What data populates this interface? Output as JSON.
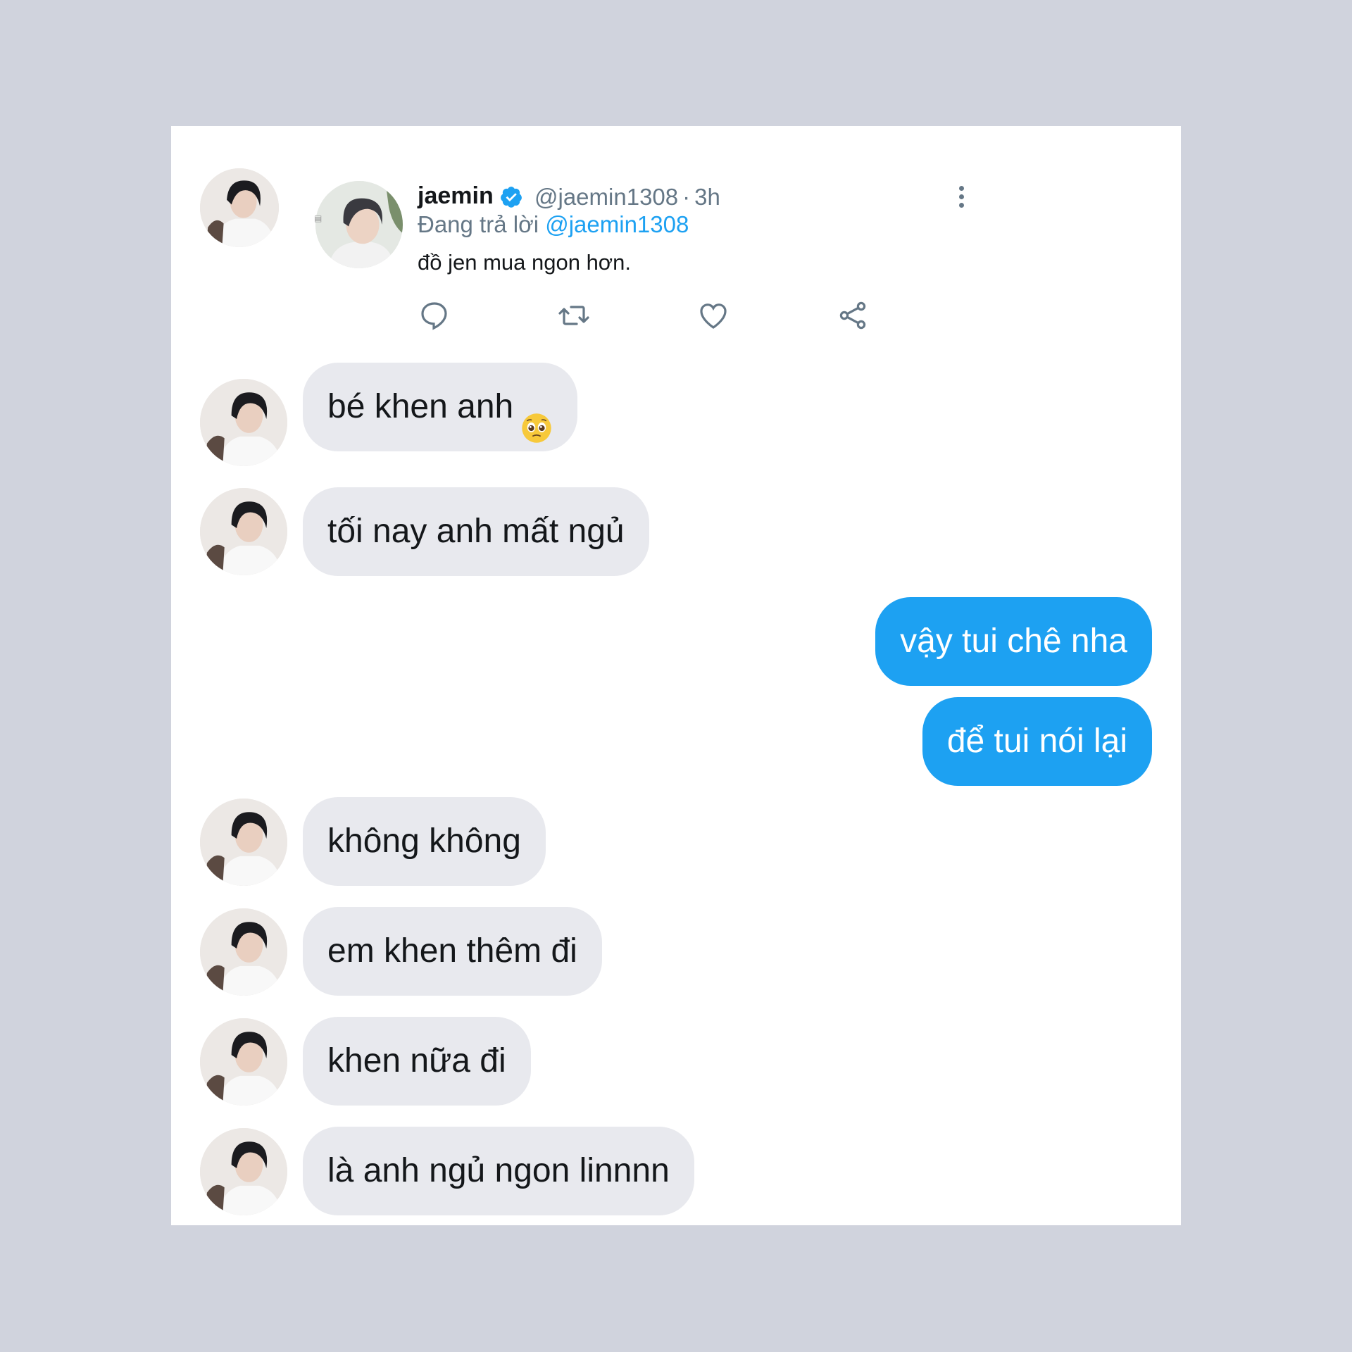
{
  "tweet": {
    "name": "jaemin",
    "handle": "@jaemin1308",
    "separator": "·",
    "time": "3h",
    "replying_prefix": "Đang trả lời",
    "replying_to": "@jaemin1308",
    "text": "đồ jen mua ngon hơn.",
    "verified_icon": "verified-badge-icon",
    "more_icon": "more-vertical-icon",
    "actions": [
      "reply-icon",
      "retweet-icon",
      "like-icon",
      "share-icon"
    ]
  },
  "messages": [
    {
      "from": "them",
      "text": "bé khen anh",
      "emoji": "pleading-face-emoji"
    },
    {
      "from": "them",
      "text": "tối nay anh mất ngủ"
    },
    {
      "from": "me",
      "text": "vậy tui chê nha"
    },
    {
      "from": "me",
      "text": "để tui nói lại"
    },
    {
      "from": "them",
      "text": "không không"
    },
    {
      "from": "them",
      "text": "em khen thêm đi"
    },
    {
      "from": "them",
      "text": "khen nữa đi"
    },
    {
      "from": "them",
      "text": "là anh ngủ ngon linnnn"
    }
  ],
  "colors": {
    "accent": "#1da1f2",
    "incoming_bubble": "#e8e9ee",
    "backdrop": "#d0d3dd",
    "muted_text": "#657786"
  }
}
